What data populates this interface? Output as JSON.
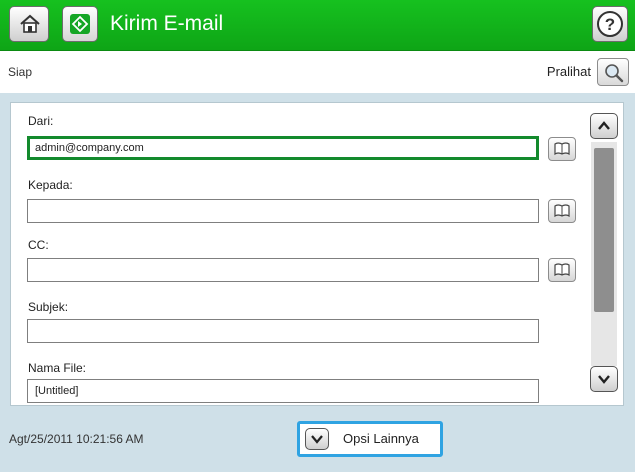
{
  "header": {
    "title": "Kirim E-mail",
    "icons": {
      "home": "home-icon",
      "app": "email-send-icon",
      "help": "help-icon"
    },
    "accent_color": "#10b31a"
  },
  "status_bar": {
    "status": "Siap",
    "preview_label": "Pralihat",
    "preview_icon": "magnifier-icon"
  },
  "form": {
    "from": {
      "label": "Dari:",
      "value": "admin@company.com"
    },
    "to": {
      "label": "Kepada:",
      "value": ""
    },
    "cc": {
      "label": "CC:",
      "value": ""
    },
    "subject": {
      "label": "Subjek:",
      "value": ""
    },
    "filename": {
      "label": "Nama File:",
      "value": "[Untitled]"
    },
    "address_book_icon": "address-book-icon"
  },
  "footer": {
    "datetime": "Agt/25/2011 10:21:56 AM",
    "more_options_label": "Opsi Lainnya"
  }
}
